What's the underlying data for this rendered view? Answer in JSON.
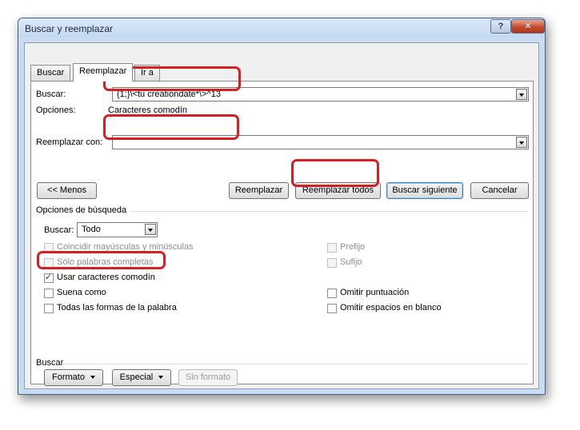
{
  "window": {
    "title": "Buscar y reemplazar"
  },
  "tabs": [
    {
      "label": "Buscar",
      "active": false
    },
    {
      "label": "Reemplazar",
      "active": true
    },
    {
      "label": "Ir a",
      "active": false
    }
  ],
  "find": {
    "label": "Buscar:",
    "value": "{1;}\\<tu creationdate*\\>^13",
    "options_label": "Opciones:",
    "options_value": "Caracteres comodín"
  },
  "replace": {
    "label": "Reemplazar con:",
    "value": ""
  },
  "buttons": {
    "less": "<< Menos",
    "replace": "Reemplazar",
    "replace_all": "Reemplazar todos",
    "find_next": "Buscar siguiente",
    "cancel": "Cancelar"
  },
  "search_options": {
    "header": "Opciones de búsqueda",
    "search_label": "Buscar:",
    "search_value": "Todo",
    "left": [
      {
        "label": "Coincidir mayúsculas y minúsculas",
        "checked": false,
        "enabled": false
      },
      {
        "label": "Sólo palabras completas",
        "checked": false,
        "enabled": false
      },
      {
        "label": "Usar caracteres comodín",
        "checked": true,
        "enabled": true
      },
      {
        "label": "Suena como",
        "checked": false,
        "enabled": true
      },
      {
        "label": "Todas las formas de la palabra",
        "checked": false,
        "enabled": true
      }
    ],
    "right": [
      {
        "label": "Prefijo",
        "checked": false,
        "enabled": false
      },
      {
        "label": "Sufijo",
        "checked": false,
        "enabled": false
      },
      {
        "label": "Omitir puntuación",
        "checked": false,
        "enabled": true
      },
      {
        "label": "Omitir espacios en blanco",
        "checked": false,
        "enabled": true
      }
    ]
  },
  "find_section": {
    "header": "Buscar",
    "format": "Formato",
    "special": "Especial",
    "no_format": "Sin formato"
  },
  "colors": {
    "highlight": "#d42020",
    "titlebar": "#c4d8f0",
    "close": "#c44b2e"
  }
}
